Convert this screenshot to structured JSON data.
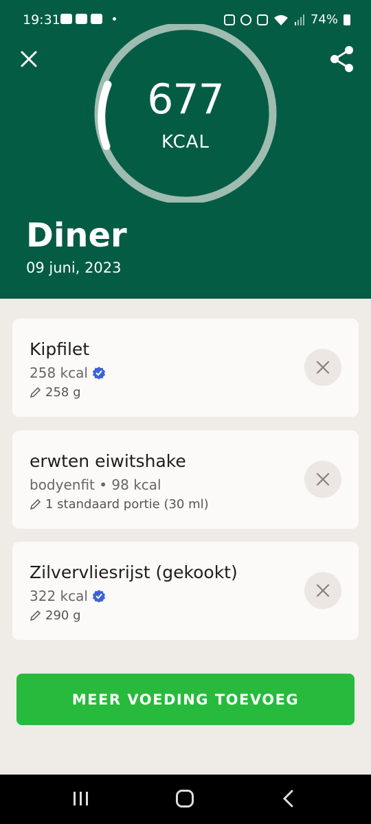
{
  "status_bar": {
    "time": "19:31",
    "battery": "74%"
  },
  "summary": {
    "kcal_value": "677",
    "kcal_unit": "KCAL",
    "ring_progress": 0.03
  },
  "meal": {
    "title": "Diner",
    "date": "09 juni, 2023"
  },
  "items": [
    {
      "name": "Kipfilet",
      "sub": "258 kcal",
      "verified": true,
      "portion": "258 g"
    },
    {
      "name": "erwten eiwitshake",
      "sub": "bodyenfit • 98 kcal",
      "verified": false,
      "portion": "1 standaard portie (30 ml)"
    },
    {
      "name": "Zilvervliesrijst (gekookt)",
      "sub": "322 kcal",
      "verified": true,
      "portion": "290 g"
    }
  ],
  "cta_label": "MEER VOEDING TOEVOEG",
  "colors": {
    "header": "#055c45",
    "cta": "#27ba3c",
    "verified": "#3a63d6"
  }
}
